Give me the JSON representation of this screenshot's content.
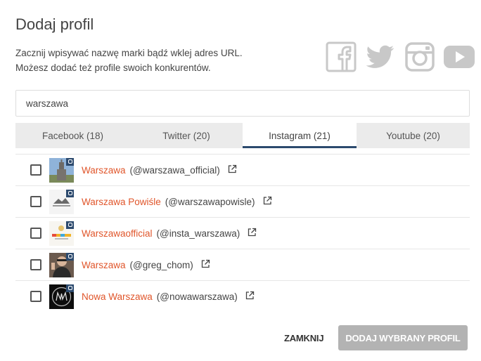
{
  "dialog": {
    "title": "Dodaj profil",
    "description_line1": "Zacznij wpisywać nazwę marki bądź wklej adres URL.",
    "description_line2": "Możesz dodać też profile swoich konkurentów."
  },
  "socials": [
    "facebook-icon",
    "twitter-icon",
    "instagram-icon",
    "youtube-icon"
  ],
  "search": {
    "value": "warszawa"
  },
  "tabs": [
    {
      "label": "Facebook (18)",
      "active": false
    },
    {
      "label": "Twitter (20)",
      "active": false
    },
    {
      "label": "Instagram (21)",
      "active": true
    },
    {
      "label": "Youtube (20)",
      "active": false
    }
  ],
  "results": [
    {
      "name": "Warszawa",
      "handle": "(@warszawa_official)",
      "checked": false
    },
    {
      "name": "Warszawa Powiśle",
      "handle": "(@warszawapowisle)",
      "checked": false
    },
    {
      "name": "Warszawaofficial",
      "handle": "(@insta_warszawa)",
      "checked": false
    },
    {
      "name": "Warszawa",
      "handle": "(@greg_chom)",
      "checked": false
    },
    {
      "name": "Nowa Warszawa",
      "handle": "(@nowawarszawa)",
      "checked": false
    }
  ],
  "footer": {
    "close_label": "ZAMKNIJ",
    "add_label": "DODAJ WYBRANY PROFIL"
  },
  "colors": {
    "accent_link": "#e0552a",
    "active_tab_underline": "#2c4a6e",
    "disabled_button": "#b3b3b3",
    "social_icons": "#c8c8c8"
  }
}
